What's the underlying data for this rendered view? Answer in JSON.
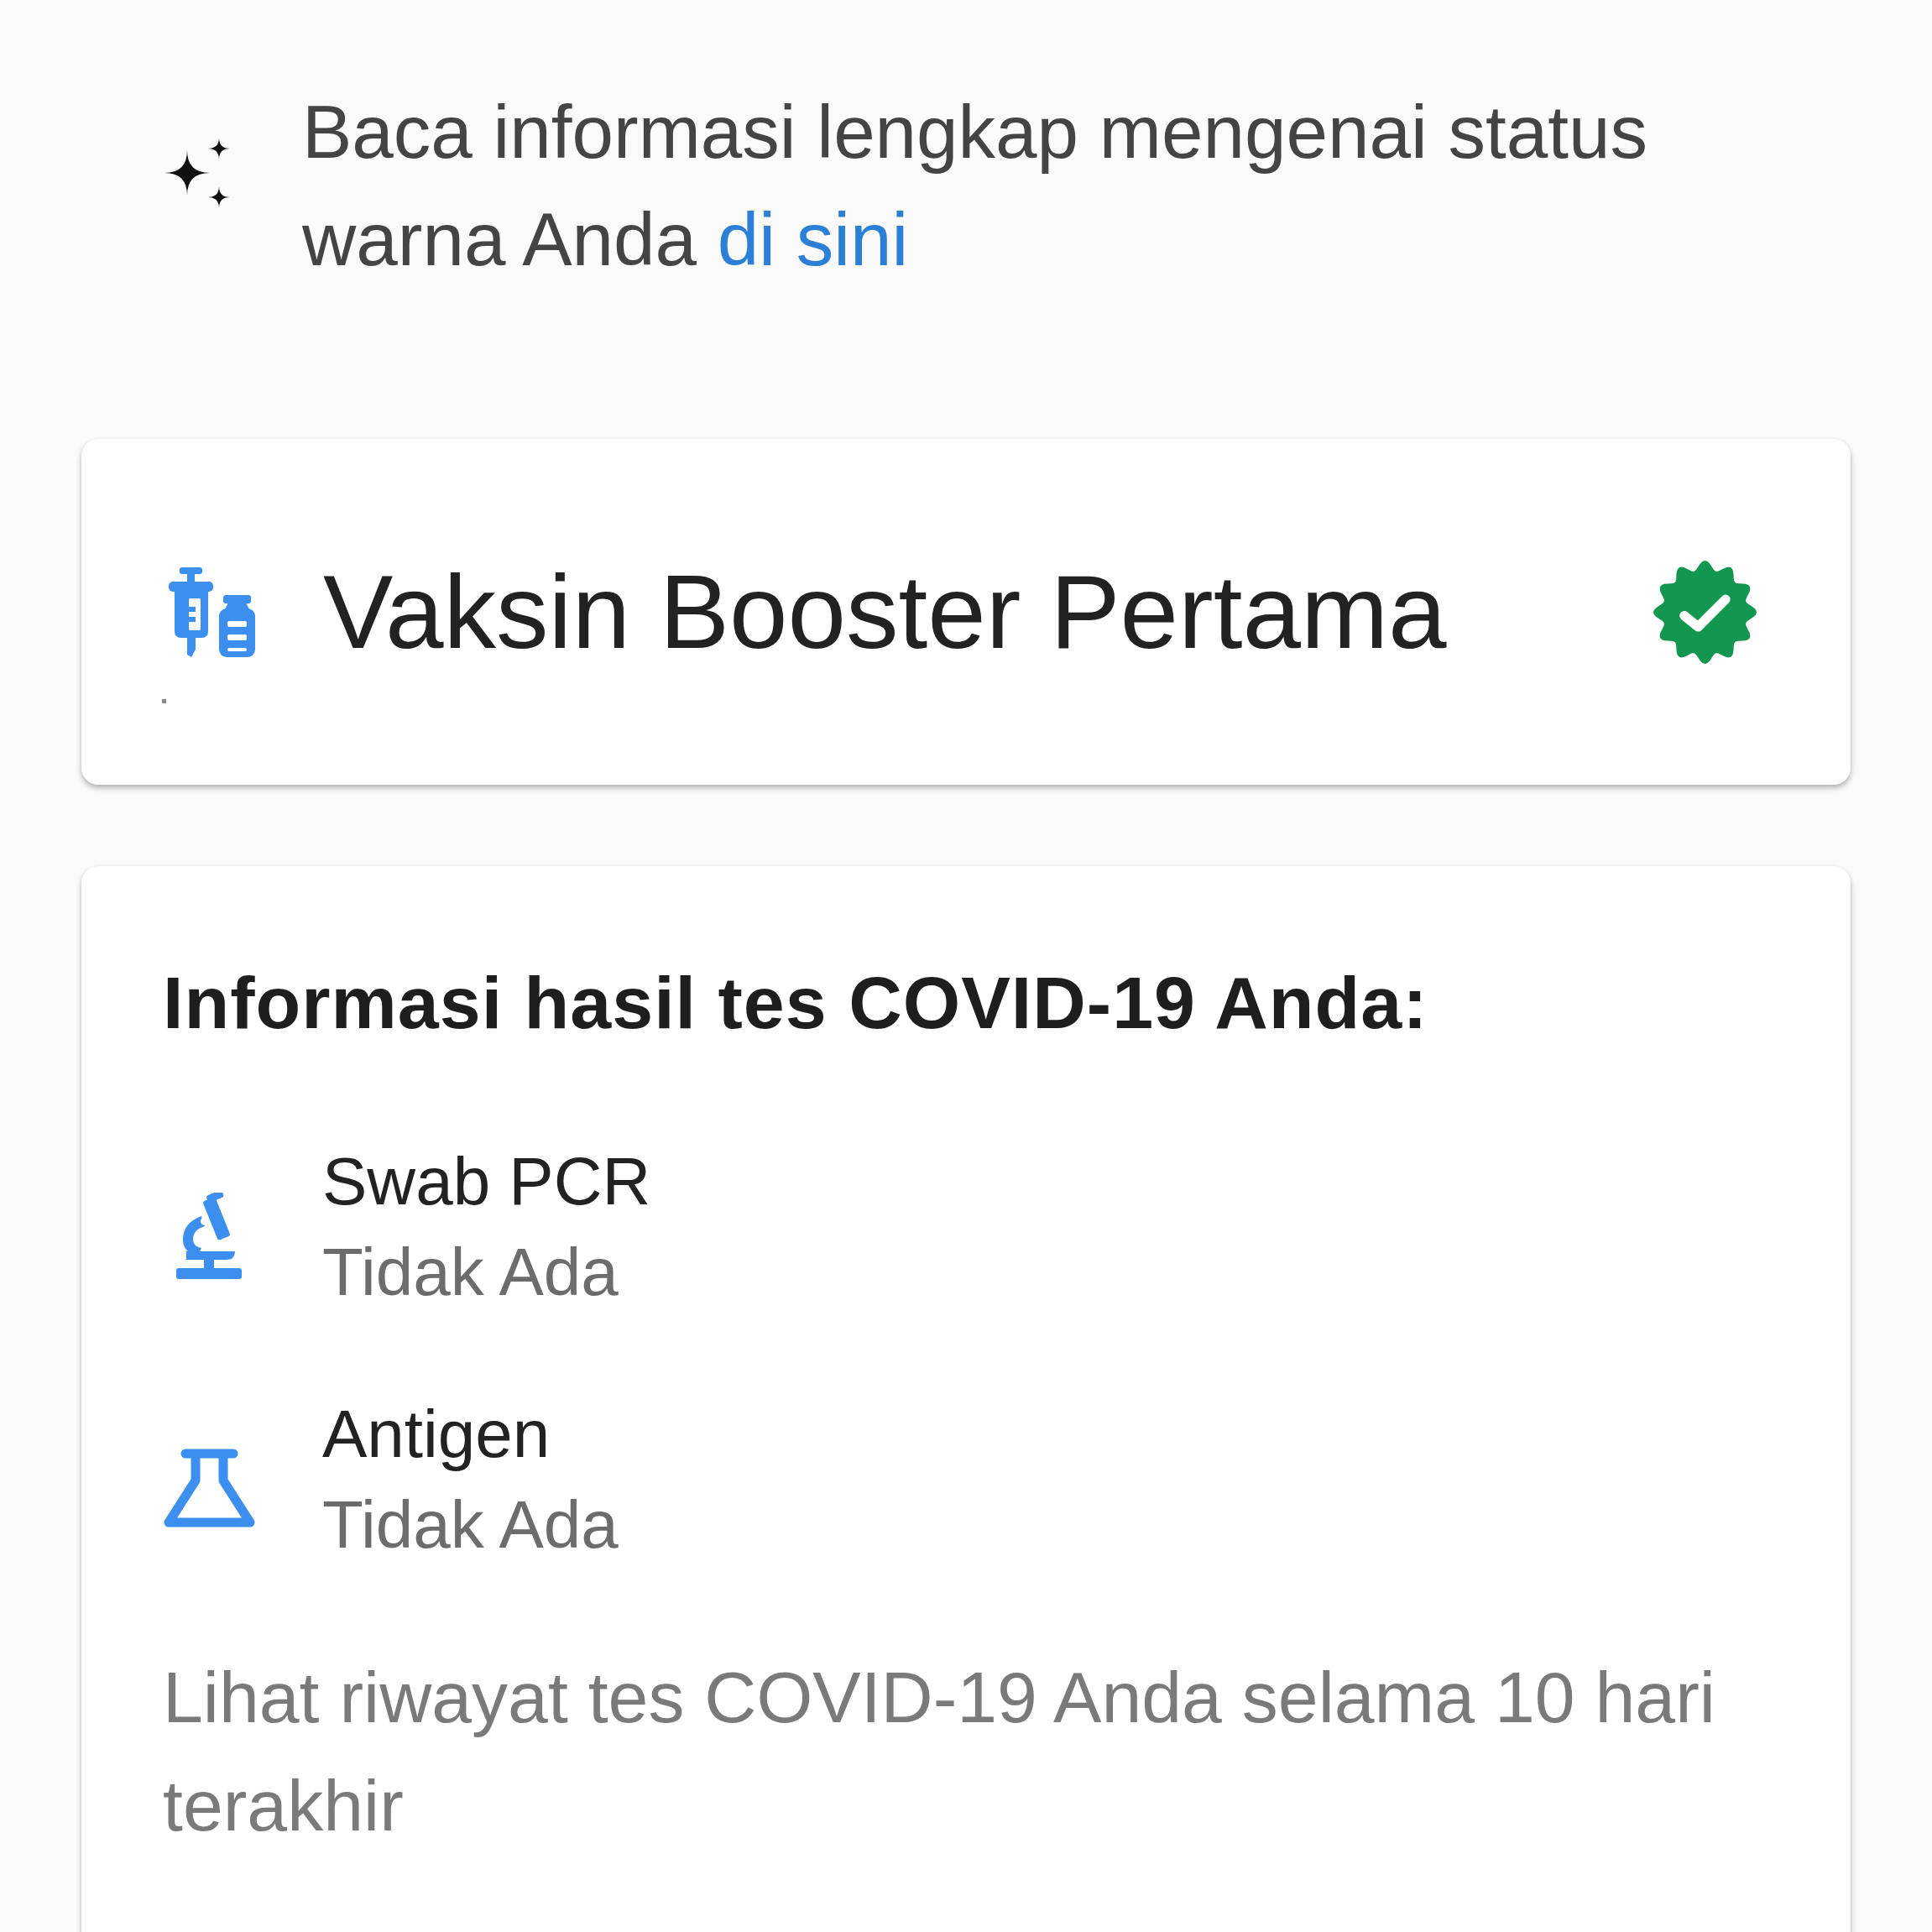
{
  "banner": {
    "text": "Baca informasi lengkap mengenai status warna Anda",
    "link": "di sini"
  },
  "vaccine_card": {
    "title": "Vaksin Booster Pertama",
    "verified": true
  },
  "test_results": {
    "heading": "Informasi hasil tes COVID-19 Anda:",
    "tests": [
      {
        "kind": "pcr",
        "name": "Swab PCR",
        "result": "Tidak Ada"
      },
      {
        "kind": "antigen",
        "name": "Antigen",
        "result": "Tidak Ada"
      }
    ],
    "history_text": "Lihat riwayat tes COVID-19 Anda selama 10 hari terakhir"
  }
}
